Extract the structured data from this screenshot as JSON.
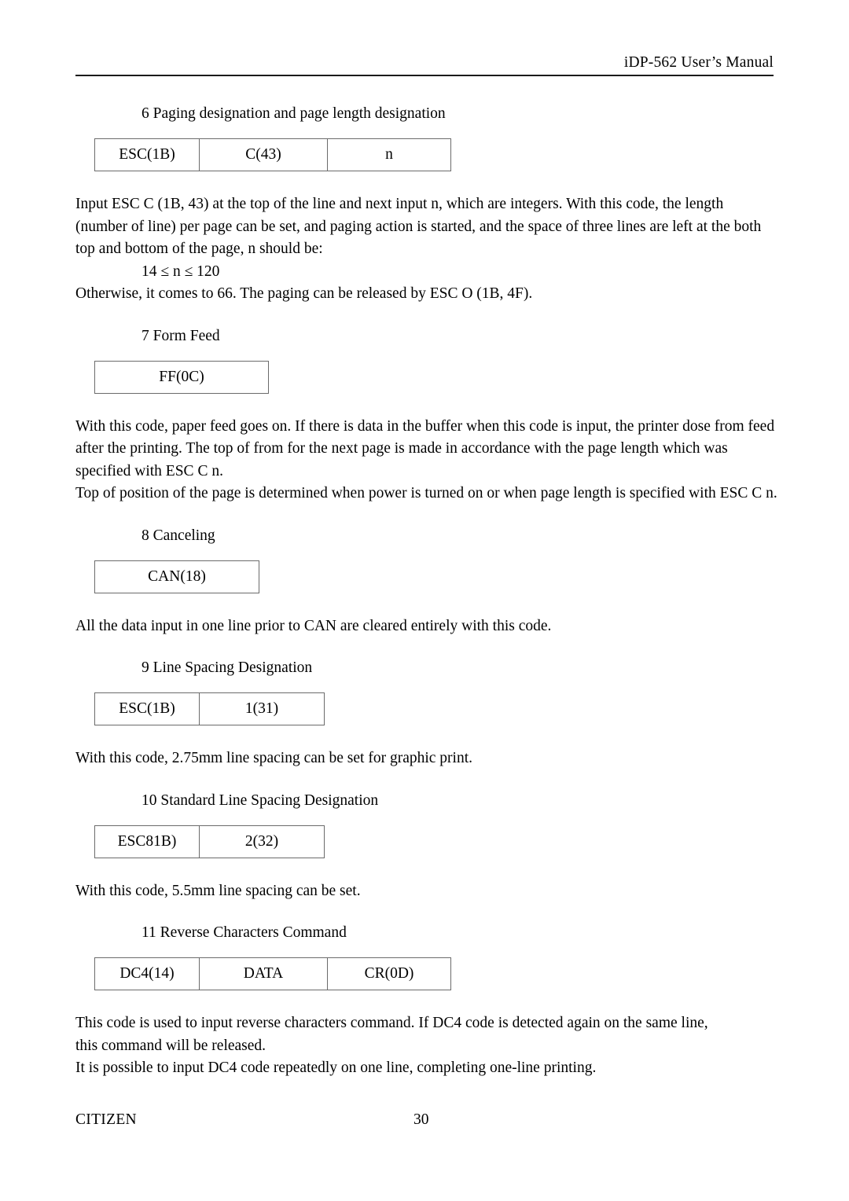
{
  "header": {
    "title": "iDP-562 User’s Manual"
  },
  "sections": [
    {
      "heading": "6 Paging designation and page length designation",
      "table": {
        "cells": [
          "ESC(1B)",
          "C(43)",
          "n"
        ],
        "widths": [
          124,
          154,
          148
        ]
      },
      "body_lines": [
        "Input ESC C (1B, 43) at the top of the line and next input n, which are integers. With this code, the length",
        "(number of line) per page can be set, and paging action is started, and the space of three lines are left at the both",
        "top and bottom of the page, n should be:"
      ],
      "indented_line": "14 ≤ n ≤ 120",
      "body_lines_after": [
        "Otherwise, it comes to 66. The paging can be released by ESC O (1B, 4F)."
      ]
    },
    {
      "heading": "7 Form Feed",
      "table": {
        "cells": [
          "FF(0C)"
        ],
        "widths": [
          212
        ]
      },
      "body_lines": [
        "With this code, paper feed goes on. If there is data in the buffer when this code is input, the printer dose from feed",
        "after the printing. The top of from for the next page is made in accordance with the page length which was",
        "specified with ESC C n.",
        "Top of position of the page is determined when power is turned on or when page length is specified with ESC C n."
      ]
    },
    {
      "heading": "8 Canceling",
      "table": {
        "cells": [
          "CAN(18)"
        ],
        "widths": [
          200
        ]
      },
      "body_lines": [
        "All the data input in one line prior to CAN are cleared entirely with this code."
      ]
    },
    {
      "heading": "9 Line Spacing Designation",
      "table": {
        "cells": [
          "ESC(1B)",
          "1(31)"
        ],
        "widths": [
          124,
          150
        ]
      },
      "body_lines": [
        "With this code, 2.75mm line spacing can be set for graphic print."
      ]
    },
    {
      "heading": "10 Standard Line Spacing Designation",
      "table": {
        "cells": [
          "ESC81B)",
          "2(32)"
        ],
        "widths": [
          124,
          150
        ]
      },
      "body_lines": [
        "With this code, 5.5mm line spacing can be set."
      ]
    },
    {
      "heading": "11 Reverse Characters Command",
      "table": {
        "cells": [
          "DC4(14)",
          "DATA",
          "CR(0D)"
        ],
        "widths": [
          124,
          154,
          148
        ]
      },
      "body_lines": [
        "This code is used to input reverse characters command. If DC4 code is detected again on the same line,",
        "this command will be released.",
        "It is possible to input DC4 code repeatedly on one line, completing one-line printing."
      ]
    }
  ],
  "footer": {
    "brand": "CITIZEN",
    "page_number": "30"
  }
}
